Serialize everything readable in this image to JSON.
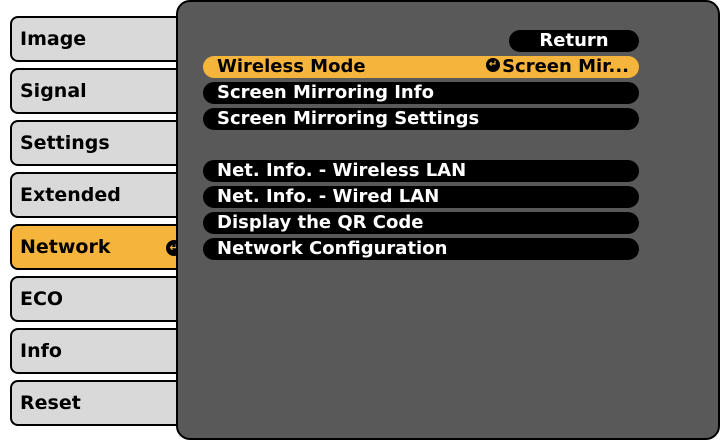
{
  "sidebar": {
    "items": [
      {
        "label": "Image"
      },
      {
        "label": "Signal"
      },
      {
        "label": "Settings"
      },
      {
        "label": "Extended"
      },
      {
        "label": "Network"
      },
      {
        "label": "ECO"
      },
      {
        "label": "Info"
      },
      {
        "label": "Reset"
      }
    ],
    "active_index": 4,
    "active_icon": "enter-icon"
  },
  "panel": {
    "return_label": "Return",
    "rows": [
      {
        "label": "Wireless Mode",
        "value": "Screen Mir...",
        "value_icon": "enter-icon"
      },
      {
        "label": "Screen Mirroring Info"
      },
      {
        "label": "Screen Mirroring Settings"
      },
      {
        "label": "Net. Info. - Wireless LAN"
      },
      {
        "label": "Net. Info. - Wired LAN"
      },
      {
        "label": "Display the QR Code"
      },
      {
        "label": "Network Configuration"
      }
    ],
    "active_row": 0
  },
  "colors": {
    "highlight": "#f5b43c",
    "panel_bg": "#595959",
    "sidebar_item_bg": "#d9d9d9",
    "row_bg": "#000000"
  }
}
